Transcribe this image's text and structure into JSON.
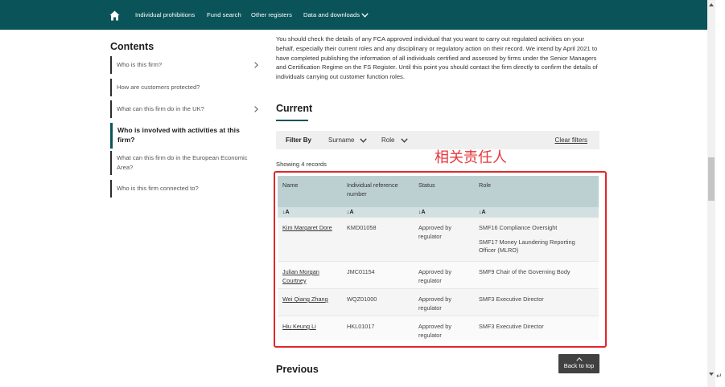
{
  "nav": {
    "items": [
      "Individual prohibitions",
      "Fund search",
      "Other registers",
      "Data and downloads"
    ]
  },
  "sidebar": {
    "title": "Contents",
    "items": [
      {
        "label": "Who is this firm?"
      },
      {
        "label": "How are customers protected?"
      },
      {
        "label": "What can this firm do in the UK?"
      },
      {
        "label": "Who is involved with activities at this firm?"
      },
      {
        "label": "What can this firm do in the European Economic Area?"
      },
      {
        "label": "Who is this firm connected to?"
      }
    ]
  },
  "intro": "You should check the details of any FCA approved individual that you want to carry out regulated activities on your behalf, especially their current roles and any disciplinary or regulatory action on their record. We intend by April 2021 to have completed publishing the information of all individuals certified and assessed by firms under the Senior Managers and Certification Regime on the FS Register. Until this point you should contact the firm directly to confirm the details of individuals carrying out customer function roles.",
  "current": {
    "title": "Current",
    "filter": {
      "label": "Filter By",
      "options": [
        "Surname",
        "Role"
      ],
      "clear": "Clear filters"
    },
    "showing": "Showing 4 records",
    "annotation": "相关责任人",
    "table": {
      "headers": [
        "Name",
        "Individual reference number",
        "Status",
        "Role"
      ],
      "sort_label": "↓A",
      "rows": [
        {
          "name": "Kim Margaret Dore",
          "ref": "KMD01058",
          "status": "Approved by regulator",
          "roles": [
            "SMF16 Compliance Oversight",
            "SMF17 Money Laundering Reporting Officer (MLRO)"
          ]
        },
        {
          "name": "Julian Morgan Courtney",
          "ref": "JMC01154",
          "status": "Approved by regulator",
          "roles": [
            "SMF9 Chair of the Governing Body"
          ]
        },
        {
          "name": "Wei Qiang Zhang",
          "ref": "WQZ01000",
          "status": "Approved by regulator",
          "roles": [
            "SMF3 Executive Director"
          ]
        },
        {
          "name": "Hiu Keung Li",
          "ref": "HKL01017",
          "status": "Approved by regulator",
          "roles": [
            "SMF3 Executive Director"
          ]
        }
      ]
    }
  },
  "previous": {
    "title": "Previous"
  },
  "back_to_top": "Back to top",
  "colors": {
    "nav_bg": "#0a5459",
    "accent": "#0a5459",
    "annotation_red": "#e0262b",
    "table_head": "#bdd0d1"
  }
}
